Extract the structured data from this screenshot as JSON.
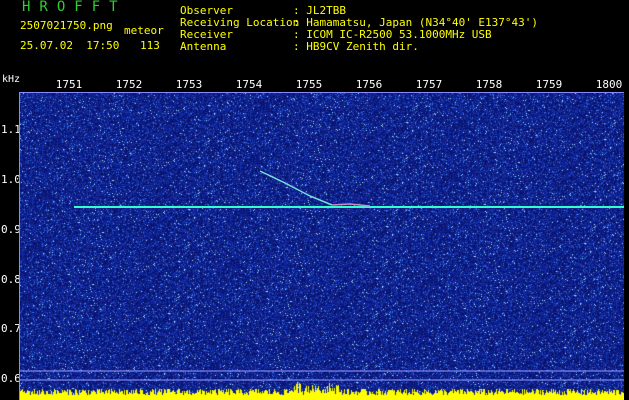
{
  "header": {
    "app_title": "HROFFT",
    "file_name": "2507021750.png",
    "meteor_label": "meteor",
    "datetime": "25.07.02  17:50",
    "meteor_count": "113"
  },
  "station": [
    {
      "key": "Observer",
      "value": ": JL2TBB"
    },
    {
      "key": "Receiving Location",
      "value": ": Hamamatsu, Japan (N34°40' E137°43')"
    },
    {
      "key": "Receiver",
      "value": ": ICOM IC-R2500 53.1000MHz USB"
    },
    {
      "key": "Antenna",
      "value": ": HB9CV Zenith dir."
    }
  ],
  "axes": {
    "y_unit": "kHz",
    "x_ticks": [
      "1751",
      "1752",
      "1753",
      "1754",
      "1755",
      "1756",
      "1757",
      "1758",
      "1759",
      "1800"
    ],
    "y_ticks": [
      "1.1",
      "1.0",
      "0.9",
      "0.8",
      "0.7",
      "0.6"
    ]
  },
  "colors": {
    "title": "#33cc33",
    "info": "#ffff00",
    "background_noise": "#1a2fa0",
    "carrier_line": "#33ffcc",
    "level_bars": "#ffff00"
  }
}
